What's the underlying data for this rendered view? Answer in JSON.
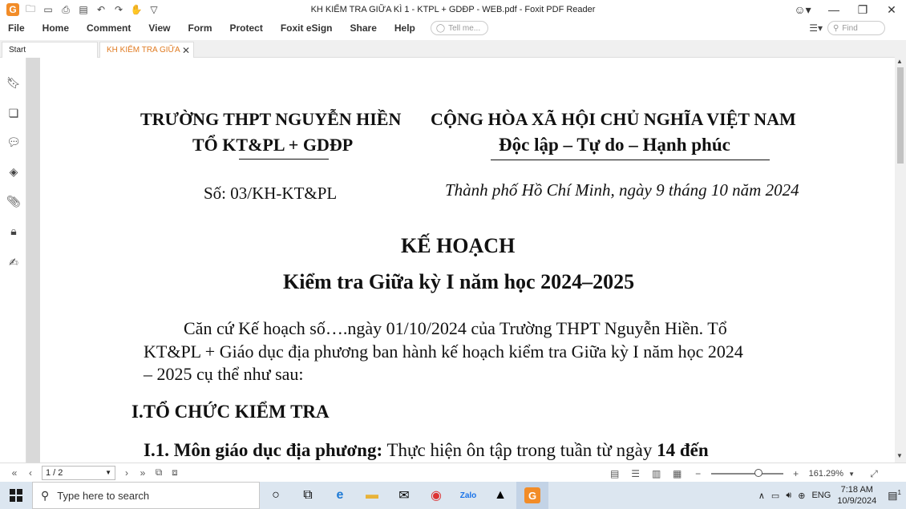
{
  "window": {
    "title": "KH KIỂM TRA GIỮA KÌ 1 - KTPL + GDĐP - WEB.pdf - Foxit PDF Reader"
  },
  "menu": {
    "items": [
      "File",
      "Home",
      "Comment",
      "View",
      "Form",
      "Protect",
      "Foxit eSign",
      "Share",
      "Help"
    ],
    "tell_me_placeholder": "Tell me...",
    "find_placeholder": "Find"
  },
  "tabs": [
    {
      "label": "Start"
    },
    {
      "label": "KH KIỂM TRA GIỮA K..."
    }
  ],
  "document": {
    "school_name": "TRƯỜNG THPT NGUYỄN HIỀN",
    "department": "TỔ KT&PL + GDĐP",
    "national_title": "CỘNG HÒA XÃ HỘI CHỦ NGHĨA VIỆT NAM",
    "motto": "Độc lập – Tự do – Hạnh phúc",
    "doc_number": "Số: 03/KH-KT&PL",
    "place_date": "Thành phố Hồ Chí Minh, ngày 9 tháng 10 năm 2024",
    "heading": "KẾ HOẠCH",
    "subheading": "Kiểm tra Giữa kỳ I năm học 2024–2025",
    "para_line1": "Căn cứ Kế hoạch số….ngày 01/10/2024 của Trường THPT Nguyễn Hiền. Tổ",
    "para_line2": "KT&PL + Giáo dục địa phương ban hành kế hoạch kiểm tra Giữa kỳ I năm học 2024",
    "para_line3": "– 2025 cụ thể như sau:",
    "section1": "I.TỔ CHỨC KIỂM TRA",
    "item1_label": "I.1. Môn giáo dục địa phương:",
    "item1_text": " Thực hiện ôn tập trong tuần từ ngày ",
    "item1_bold_tail": "14 đến"
  },
  "status": {
    "page_indicator": "1 / 2",
    "zoom": "161.29%",
    "zoom_level_percent": 161.29
  },
  "taskbar": {
    "search_placeholder": "Type here to search",
    "language": "ENG",
    "time": "7:18 AM",
    "date": "10/9/2024",
    "notification_count": "1"
  }
}
